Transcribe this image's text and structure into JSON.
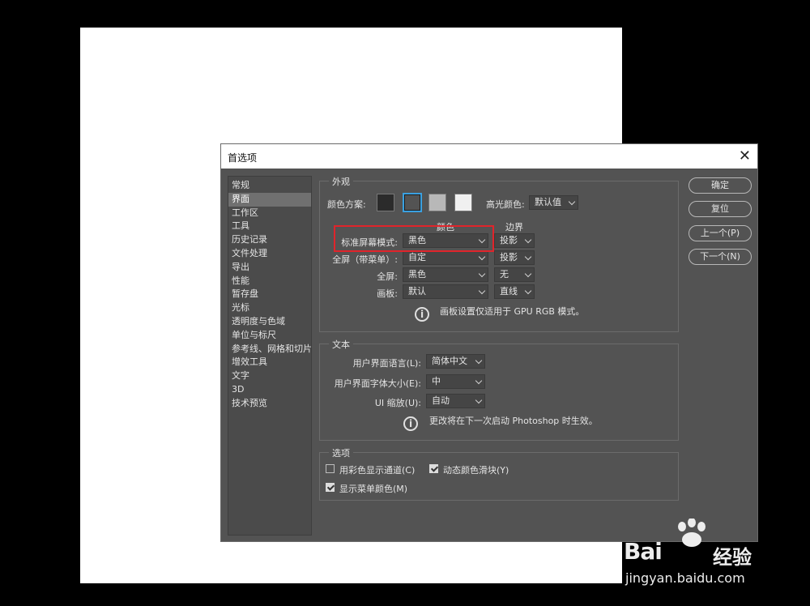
{
  "dialog": {
    "title": "首选项",
    "close_glyph": "✕"
  },
  "sidebar": {
    "items": [
      {
        "label": "常规"
      },
      {
        "label": "界面",
        "selected": true
      },
      {
        "label": "工作区"
      },
      {
        "label": "工具"
      },
      {
        "label": "历史记录"
      },
      {
        "label": "文件处理"
      },
      {
        "label": "导出"
      },
      {
        "label": "性能"
      },
      {
        "label": "暂存盘"
      },
      {
        "label": "光标"
      },
      {
        "label": "透明度与色域"
      },
      {
        "label": "单位与标尺"
      },
      {
        "label": "参考线、网格和切片"
      },
      {
        "label": "增效工具"
      },
      {
        "label": "文字"
      },
      {
        "label": "3D"
      },
      {
        "label": "技术预览"
      }
    ]
  },
  "appearance": {
    "title": "外观",
    "color_scheme_label": "颜色方案:",
    "color_swatches": [
      "#2b2b2b",
      "#535353",
      "#b8b8b8",
      "#f0f0f0"
    ],
    "selected_swatch_index": 1,
    "highlight_color_label": "高光颜色:",
    "highlight_color_value": "默认值",
    "col_color": "颜色",
    "col_border": "边界",
    "rows": [
      {
        "label": "标准屏幕模式:",
        "color": "黑色",
        "border": "投影"
      },
      {
        "label": "全屏（带菜单）:",
        "color": "自定",
        "border": "投影"
      },
      {
        "label": "全屏:",
        "color": "黑色",
        "border": "无"
      },
      {
        "label": "画板:",
        "color": "默认",
        "border": "直线"
      }
    ],
    "info_text": "画板设置仅适用于 GPU RGB 模式。"
  },
  "text_section": {
    "title": "文本",
    "ui_language_label": "用户界面语言(L):",
    "ui_language_value": "简体中文",
    "ui_font_size_label": "用户界面字体大小(E):",
    "ui_font_size_value": "中",
    "ui_scale_label": "UI 缩放(U):",
    "ui_scale_value": "自动",
    "info_text": "更改将在下一次启动 Photoshop 时生效。"
  },
  "options": {
    "title": "选项",
    "color_channels_label": "用彩色显示通道(C)",
    "color_channels_checked": false,
    "dynamic_sliders_label": "动态颜色滑块(Y)",
    "dynamic_sliders_checked": true,
    "menu_colors_label": "显示菜单颜色(M)",
    "menu_colors_checked": true
  },
  "buttons": {
    "ok": "确定",
    "reset": "复位",
    "prev": "上一个(P)",
    "next": "下一个(N)"
  },
  "watermark": {
    "logo_text": "Bai",
    "logo_text_2": "经验",
    "url": "jingyan.baidu.com"
  },
  "colors": {
    "dialog_bg": "#535353",
    "highlight_box": "#e0242b",
    "selected_swatch_border": "#3aa0e0"
  }
}
